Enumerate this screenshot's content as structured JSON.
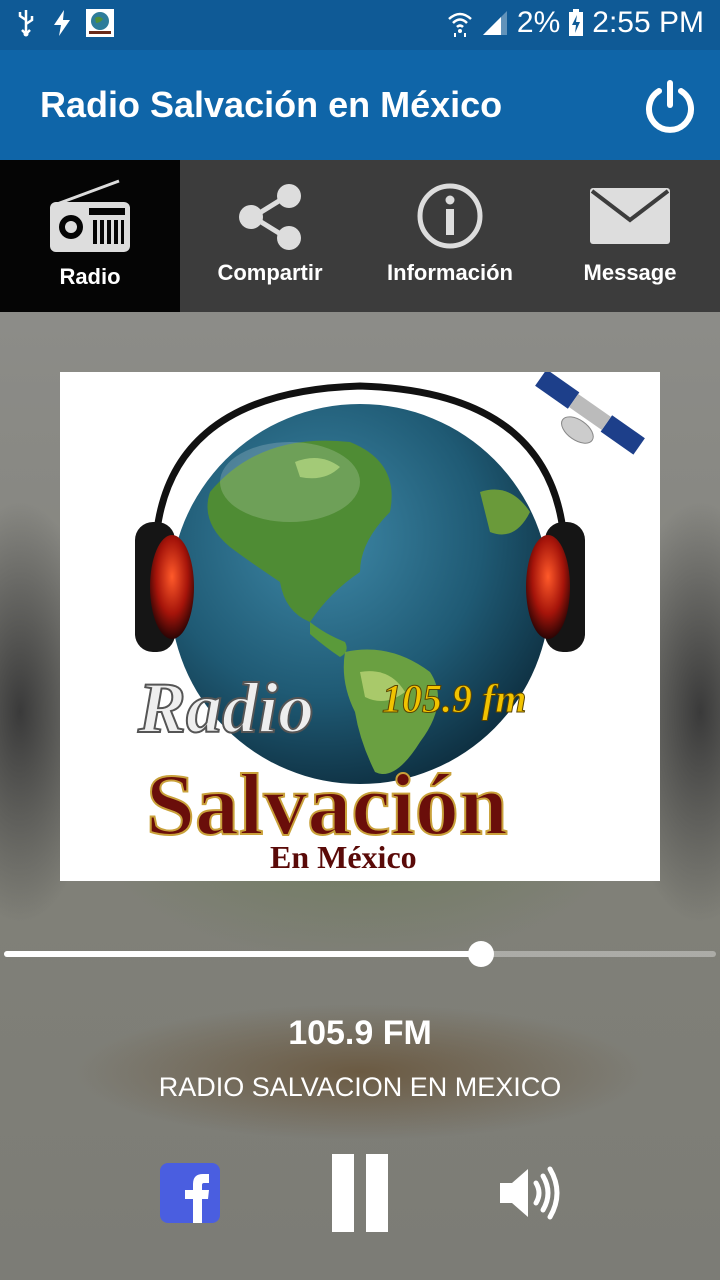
{
  "status_bar": {
    "battery": "2%",
    "time": "2:55 PM",
    "icons": [
      "usb-icon",
      "flash-icon",
      "app-notification-icon",
      "wifi-icon",
      "signal-icon",
      "battery-charging-icon"
    ]
  },
  "app_bar": {
    "title": "Radio Salvación en México",
    "power_icon": "power-icon"
  },
  "tabs": [
    {
      "label": "Radio",
      "icon": "radio-icon",
      "active": true
    },
    {
      "label": "Compartir",
      "icon": "share-icon",
      "active": false
    },
    {
      "label": "Información",
      "icon": "info-icon",
      "active": false
    },
    {
      "label": "Message",
      "icon": "mail-icon",
      "active": false
    }
  ],
  "album_art": {
    "logo_text_line1": "Radio",
    "logo_freq": "105.9 fm",
    "logo_text_line2": "Salvación",
    "logo_text_line3": "En México"
  },
  "player": {
    "progress": 0.67,
    "frequency": "105.9 FM",
    "station_name": "RADIO SALVACION EN MEXICO",
    "controls": [
      "facebook-icon",
      "pause-icon",
      "volume-icon"
    ]
  },
  "colors": {
    "status_bar": "#0f5a96",
    "app_bar": "#0f65a8",
    "tab_bar": "#3c3c3c",
    "tab_active": "#050505",
    "facebook": "#4a5ee0"
  }
}
